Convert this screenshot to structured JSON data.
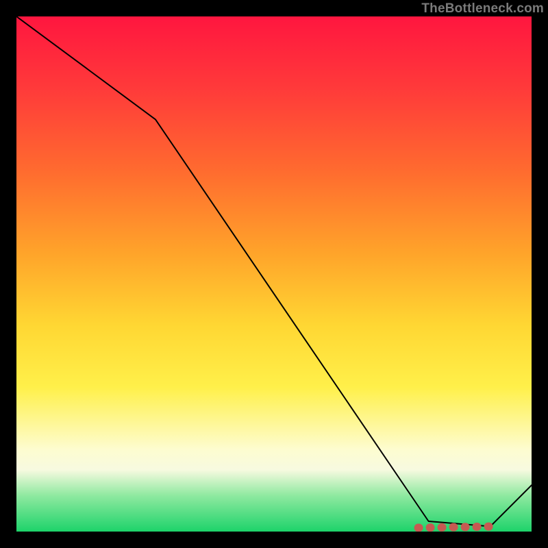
{
  "attribution": "TheBottleneck.com",
  "chart_data": {
    "type": "line",
    "title": "",
    "xlabel": "",
    "ylabel": "",
    "xlim": [
      0,
      100
    ],
    "ylim": [
      0,
      100
    ],
    "grid": false,
    "legend": false,
    "x": [
      0,
      27,
      80,
      92,
      100
    ],
    "values": [
      100,
      80,
      2,
      1,
      9
    ],
    "highlight_segment": {
      "x_from": 78,
      "x_to": 93,
      "y": 1
    },
    "gradient_stops": [
      {
        "pct": 0,
        "color": "#ff163f"
      },
      {
        "pct": 14,
        "color": "#ff3a3a"
      },
      {
        "pct": 30,
        "color": "#ff6b2f"
      },
      {
        "pct": 46,
        "color": "#ffa42a"
      },
      {
        "pct": 60,
        "color": "#ffd733"
      },
      {
        "pct": 72,
        "color": "#fff04a"
      },
      {
        "pct": 84,
        "color": "#fdfccf"
      },
      {
        "pct": 88,
        "color": "#f7fae0"
      },
      {
        "pct": 93,
        "color": "#8fe9a0"
      },
      {
        "pct": 100,
        "color": "#1dd36a"
      }
    ]
  }
}
